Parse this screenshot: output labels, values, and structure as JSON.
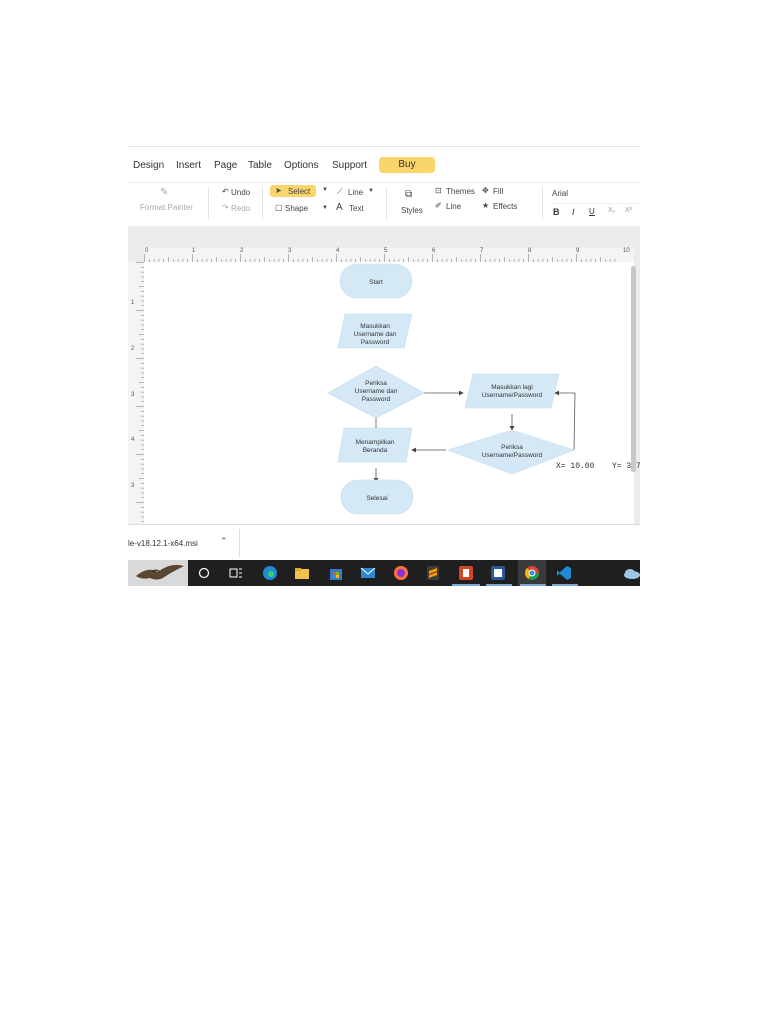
{
  "menu": [
    "Design",
    "Insert",
    "Page",
    "Table",
    "Options",
    "Support"
  ],
  "buy_label": "Buy",
  "toolbar": {
    "format_painter": "Format Painter",
    "undo": "Undo",
    "redo": "Redo",
    "select": "Select",
    "shape": "Shape",
    "line": "Line",
    "text": "Text",
    "styles": "Styles",
    "themes": "Themes",
    "line2": "Line",
    "fill": "Fill",
    "effects": "Effects",
    "font": "Arial",
    "bold": "B",
    "italic": "I",
    "underline": "U",
    "subscript": "X₂",
    "superscript": "X²"
  },
  "ruler": {
    "h": [
      "0",
      "1",
      "2",
      "3",
      "4",
      "5",
      "6",
      "7",
      "8",
      "9",
      "10"
    ],
    "v": [
      "1",
      "2",
      "3",
      "4",
      "3"
    ]
  },
  "flowchart": {
    "start": "Start",
    "input": [
      "Masukkan",
      "Username dan",
      "Password"
    ],
    "check": [
      "Periksa",
      "Username dan",
      "Password"
    ],
    "reenter": [
      "Masukkan lagi",
      "Username/Password"
    ],
    "recheck": [
      "Periksa",
      "Username/Password"
    ],
    "home": [
      "Menampilkan",
      "Beranda"
    ],
    "end": "Selesai"
  },
  "coords": {
    "x": "X= 10.00",
    "y": "Y= 3.7"
  },
  "download": {
    "file": "le-v18.12.1-x64.msi"
  },
  "colors": {
    "accent": "#f9d56b",
    "shape_fill": "#d4e8f5",
    "taskbar": "#1f1f1f"
  }
}
